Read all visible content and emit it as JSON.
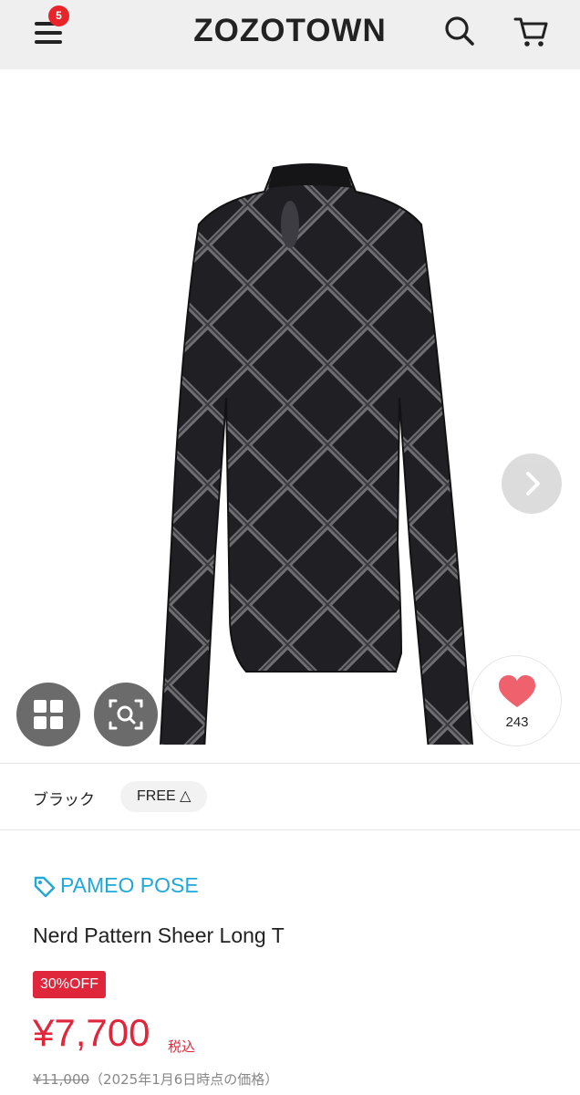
{
  "header": {
    "logo": "ZOZOTOWN",
    "menu_badge": "5"
  },
  "product": {
    "favorite_count": "243",
    "color": "ブラック",
    "size": "FREE △",
    "brand": "PAMEO POSE",
    "title": "Nerd Pattern Sheer Long T",
    "discount": "30%OFF",
    "price": "¥7,700",
    "tax_label": "税込",
    "original_price": "¥11,000",
    "price_note": "（2025年1月6日時点の価格）"
  },
  "colors": {
    "accent_red": "#e0263b",
    "brand_blue": "#20a8d8",
    "heart": "#f0616e"
  },
  "icons": [
    "menu-icon",
    "search-icon",
    "cart-icon",
    "chevron-right-icon",
    "grid-icon",
    "zoom-icon",
    "heart-icon",
    "tag-icon"
  ]
}
